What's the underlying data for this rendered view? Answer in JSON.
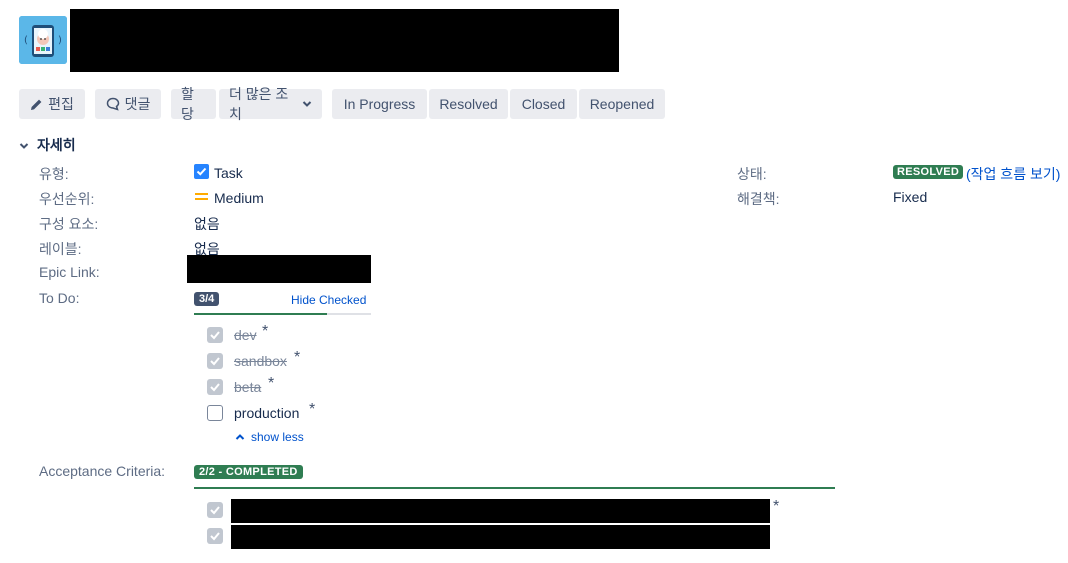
{
  "toolbar": {
    "edit": "편집",
    "comment": "댓글",
    "assign": "할당",
    "more_actions": "더 많은 조치",
    "transitions": [
      "In Progress",
      "Resolved",
      "Closed",
      "Reopened"
    ]
  },
  "details": {
    "section_title": "자세히",
    "type_label": "유형:",
    "type_value": "Task",
    "priority_label": "우선순위:",
    "priority_value": "Medium",
    "component_label": "구성 요소:",
    "component_value": "없음",
    "labels_label": "레이블:",
    "labels_value": "없음",
    "epic_label": "Epic Link:",
    "status_label": "상태:",
    "status_value": "RESOLVED",
    "workflow_link": "(작업 흐름 보기)",
    "resolution_label": "해결책:",
    "resolution_value": "Fixed"
  },
  "todo": {
    "label": "To Do:",
    "count": "3/4",
    "progress_fraction": 0.75,
    "hide_checked": "Hide Checked",
    "items": [
      {
        "text": "dev",
        "checked": true,
        "mandatory": "*"
      },
      {
        "text": "sandbox",
        "checked": true,
        "mandatory": "*"
      },
      {
        "text": "beta",
        "checked": true,
        "mandatory": "*"
      },
      {
        "text": "production",
        "checked": false,
        "mandatory": "*"
      }
    ],
    "show_less": "show less"
  },
  "acceptance": {
    "label": "Acceptance Criteria:",
    "status": "2/2 - COMPLETED",
    "progress_fraction": 1.0,
    "items": [
      {
        "checked": true,
        "mandatory": "*"
      },
      {
        "checked": true,
        "mandatory": ""
      }
    ]
  },
  "colors": {
    "resolved_green": "#2f7d52",
    "link_blue": "#0052cc",
    "check_blue": "#2684ff",
    "priority_orange": "#ffab00"
  }
}
